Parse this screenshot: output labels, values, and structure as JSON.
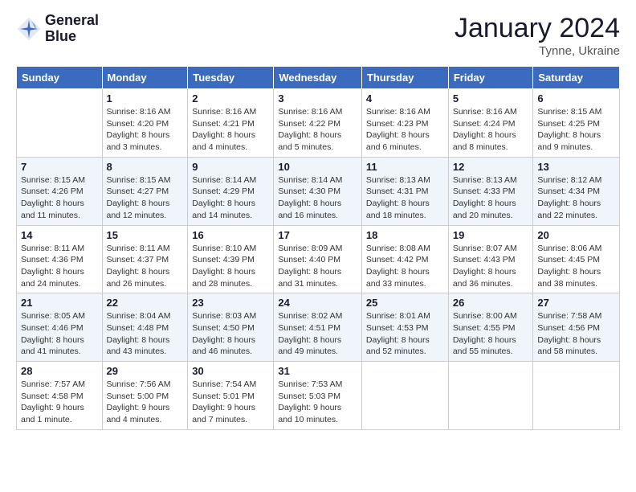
{
  "logo": {
    "line1": "General",
    "line2": "Blue"
  },
  "title": "January 2024",
  "location": "Tynne, Ukraine",
  "weekdays": [
    "Sunday",
    "Monday",
    "Tuesday",
    "Wednesday",
    "Thursday",
    "Friday",
    "Saturday"
  ],
  "weeks": [
    [
      {
        "day": "",
        "sunrise": "",
        "sunset": "",
        "daylight": ""
      },
      {
        "day": "1",
        "sunrise": "Sunrise: 8:16 AM",
        "sunset": "Sunset: 4:20 PM",
        "daylight": "Daylight: 8 hours and 3 minutes."
      },
      {
        "day": "2",
        "sunrise": "Sunrise: 8:16 AM",
        "sunset": "Sunset: 4:21 PM",
        "daylight": "Daylight: 8 hours and 4 minutes."
      },
      {
        "day": "3",
        "sunrise": "Sunrise: 8:16 AM",
        "sunset": "Sunset: 4:22 PM",
        "daylight": "Daylight: 8 hours and 5 minutes."
      },
      {
        "day": "4",
        "sunrise": "Sunrise: 8:16 AM",
        "sunset": "Sunset: 4:23 PM",
        "daylight": "Daylight: 8 hours and 6 minutes."
      },
      {
        "day": "5",
        "sunrise": "Sunrise: 8:16 AM",
        "sunset": "Sunset: 4:24 PM",
        "daylight": "Daylight: 8 hours and 8 minutes."
      },
      {
        "day": "6",
        "sunrise": "Sunrise: 8:15 AM",
        "sunset": "Sunset: 4:25 PM",
        "daylight": "Daylight: 8 hours and 9 minutes."
      }
    ],
    [
      {
        "day": "7",
        "sunrise": "Sunrise: 8:15 AM",
        "sunset": "Sunset: 4:26 PM",
        "daylight": "Daylight: 8 hours and 11 minutes."
      },
      {
        "day": "8",
        "sunrise": "Sunrise: 8:15 AM",
        "sunset": "Sunset: 4:27 PM",
        "daylight": "Daylight: 8 hours and 12 minutes."
      },
      {
        "day": "9",
        "sunrise": "Sunrise: 8:14 AM",
        "sunset": "Sunset: 4:29 PM",
        "daylight": "Daylight: 8 hours and 14 minutes."
      },
      {
        "day": "10",
        "sunrise": "Sunrise: 8:14 AM",
        "sunset": "Sunset: 4:30 PM",
        "daylight": "Daylight: 8 hours and 16 minutes."
      },
      {
        "day": "11",
        "sunrise": "Sunrise: 8:13 AM",
        "sunset": "Sunset: 4:31 PM",
        "daylight": "Daylight: 8 hours and 18 minutes."
      },
      {
        "day": "12",
        "sunrise": "Sunrise: 8:13 AM",
        "sunset": "Sunset: 4:33 PM",
        "daylight": "Daylight: 8 hours and 20 minutes."
      },
      {
        "day": "13",
        "sunrise": "Sunrise: 8:12 AM",
        "sunset": "Sunset: 4:34 PM",
        "daylight": "Daylight: 8 hours and 22 minutes."
      }
    ],
    [
      {
        "day": "14",
        "sunrise": "Sunrise: 8:11 AM",
        "sunset": "Sunset: 4:36 PM",
        "daylight": "Daylight: 8 hours and 24 minutes."
      },
      {
        "day": "15",
        "sunrise": "Sunrise: 8:11 AM",
        "sunset": "Sunset: 4:37 PM",
        "daylight": "Daylight: 8 hours and 26 minutes."
      },
      {
        "day": "16",
        "sunrise": "Sunrise: 8:10 AM",
        "sunset": "Sunset: 4:39 PM",
        "daylight": "Daylight: 8 hours and 28 minutes."
      },
      {
        "day": "17",
        "sunrise": "Sunrise: 8:09 AM",
        "sunset": "Sunset: 4:40 PM",
        "daylight": "Daylight: 8 hours and 31 minutes."
      },
      {
        "day": "18",
        "sunrise": "Sunrise: 8:08 AM",
        "sunset": "Sunset: 4:42 PM",
        "daylight": "Daylight: 8 hours and 33 minutes."
      },
      {
        "day": "19",
        "sunrise": "Sunrise: 8:07 AM",
        "sunset": "Sunset: 4:43 PM",
        "daylight": "Daylight: 8 hours and 36 minutes."
      },
      {
        "day": "20",
        "sunrise": "Sunrise: 8:06 AM",
        "sunset": "Sunset: 4:45 PM",
        "daylight": "Daylight: 8 hours and 38 minutes."
      }
    ],
    [
      {
        "day": "21",
        "sunrise": "Sunrise: 8:05 AM",
        "sunset": "Sunset: 4:46 PM",
        "daylight": "Daylight: 8 hours and 41 minutes."
      },
      {
        "day": "22",
        "sunrise": "Sunrise: 8:04 AM",
        "sunset": "Sunset: 4:48 PM",
        "daylight": "Daylight: 8 hours and 43 minutes."
      },
      {
        "day": "23",
        "sunrise": "Sunrise: 8:03 AM",
        "sunset": "Sunset: 4:50 PM",
        "daylight": "Daylight: 8 hours and 46 minutes."
      },
      {
        "day": "24",
        "sunrise": "Sunrise: 8:02 AM",
        "sunset": "Sunset: 4:51 PM",
        "daylight": "Daylight: 8 hours and 49 minutes."
      },
      {
        "day": "25",
        "sunrise": "Sunrise: 8:01 AM",
        "sunset": "Sunset: 4:53 PM",
        "daylight": "Daylight: 8 hours and 52 minutes."
      },
      {
        "day": "26",
        "sunrise": "Sunrise: 8:00 AM",
        "sunset": "Sunset: 4:55 PM",
        "daylight": "Daylight: 8 hours and 55 minutes."
      },
      {
        "day": "27",
        "sunrise": "Sunrise: 7:58 AM",
        "sunset": "Sunset: 4:56 PM",
        "daylight": "Daylight: 8 hours and 58 minutes."
      }
    ],
    [
      {
        "day": "28",
        "sunrise": "Sunrise: 7:57 AM",
        "sunset": "Sunset: 4:58 PM",
        "daylight": "Daylight: 9 hours and 1 minute."
      },
      {
        "day": "29",
        "sunrise": "Sunrise: 7:56 AM",
        "sunset": "Sunset: 5:00 PM",
        "daylight": "Daylight: 9 hours and 4 minutes."
      },
      {
        "day": "30",
        "sunrise": "Sunrise: 7:54 AM",
        "sunset": "Sunset: 5:01 PM",
        "daylight": "Daylight: 9 hours and 7 minutes."
      },
      {
        "day": "31",
        "sunrise": "Sunrise: 7:53 AM",
        "sunset": "Sunset: 5:03 PM",
        "daylight": "Daylight: 9 hours and 10 minutes."
      },
      {
        "day": "",
        "sunrise": "",
        "sunset": "",
        "daylight": ""
      },
      {
        "day": "",
        "sunrise": "",
        "sunset": "",
        "daylight": ""
      },
      {
        "day": "",
        "sunrise": "",
        "sunset": "",
        "daylight": ""
      }
    ]
  ]
}
